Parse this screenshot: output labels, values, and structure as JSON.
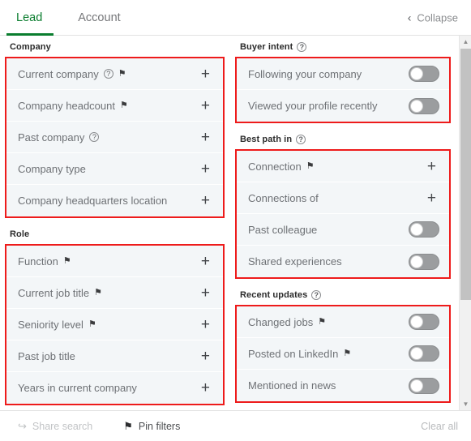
{
  "header": {
    "tabs": [
      {
        "label": "Lead",
        "active": true
      },
      {
        "label": "Account",
        "active": false
      }
    ],
    "collapse": {
      "label": "Collapse",
      "icon": "chevron-left-icon",
      "glyph": "‹"
    }
  },
  "icons": {
    "help": "?",
    "pin": "⚑",
    "plus": "+",
    "share": "↪",
    "scroll_up": "▲",
    "scroll_down": "▼"
  },
  "left_column": [
    {
      "title": "Company",
      "has_help": false,
      "highlighted": true,
      "rows": [
        {
          "label": "Current company",
          "help": true,
          "pin": true,
          "control": "plus"
        },
        {
          "label": "Company headcount",
          "help": false,
          "pin": true,
          "control": "plus"
        },
        {
          "label": "Past company",
          "help": true,
          "pin": false,
          "control": "plus"
        },
        {
          "label": "Company type",
          "help": false,
          "pin": false,
          "control": "plus"
        },
        {
          "label": "Company headquarters location",
          "help": false,
          "pin": false,
          "control": "plus"
        }
      ]
    },
    {
      "title": "Role",
      "has_help": false,
      "highlighted": true,
      "rows": [
        {
          "label": "Function",
          "help": false,
          "pin": true,
          "control": "plus"
        },
        {
          "label": "Current job title",
          "help": false,
          "pin": true,
          "control": "plus"
        },
        {
          "label": "Seniority level",
          "help": false,
          "pin": true,
          "control": "plus"
        },
        {
          "label": "Past job title",
          "help": false,
          "pin": false,
          "control": "plus"
        },
        {
          "label": "Years in current company",
          "help": false,
          "pin": false,
          "control": "plus"
        }
      ]
    }
  ],
  "right_column": [
    {
      "title": "Buyer intent",
      "has_help": true,
      "highlighted": true,
      "rows": [
        {
          "label": "Following your company",
          "help": false,
          "pin": false,
          "control": "toggle",
          "on": false
        },
        {
          "label": "Viewed your profile recently",
          "help": false,
          "pin": false,
          "control": "toggle",
          "on": false
        }
      ]
    },
    {
      "title": "Best path in",
      "has_help": true,
      "highlighted": true,
      "rows": [
        {
          "label": "Connection",
          "help": false,
          "pin": true,
          "control": "plus"
        },
        {
          "label": "Connections of",
          "help": false,
          "pin": false,
          "control": "plus"
        },
        {
          "label": "Past colleague",
          "help": false,
          "pin": false,
          "control": "toggle",
          "on": false
        },
        {
          "label": "Shared experiences",
          "help": false,
          "pin": false,
          "control": "toggle",
          "on": false
        }
      ]
    },
    {
      "title": "Recent updates",
      "has_help": true,
      "highlighted": true,
      "rows": [
        {
          "label": "Changed jobs",
          "help": false,
          "pin": true,
          "control": "toggle",
          "on": false
        },
        {
          "label": "Posted on LinkedIn",
          "help": false,
          "pin": true,
          "control": "toggle",
          "on": false
        },
        {
          "label": "Mentioned in news",
          "help": false,
          "pin": false,
          "control": "toggle",
          "on": false
        }
      ]
    }
  ],
  "footer": {
    "share_search": "Share search",
    "pin_filters": "Pin filters",
    "clear_all": "Clear all"
  },
  "colors": {
    "accent_green": "#0a7d2e",
    "annotation_red": "#ee1b1b",
    "row_bg": "#f3f6f8",
    "toggle_off": "#9b9d9f"
  }
}
